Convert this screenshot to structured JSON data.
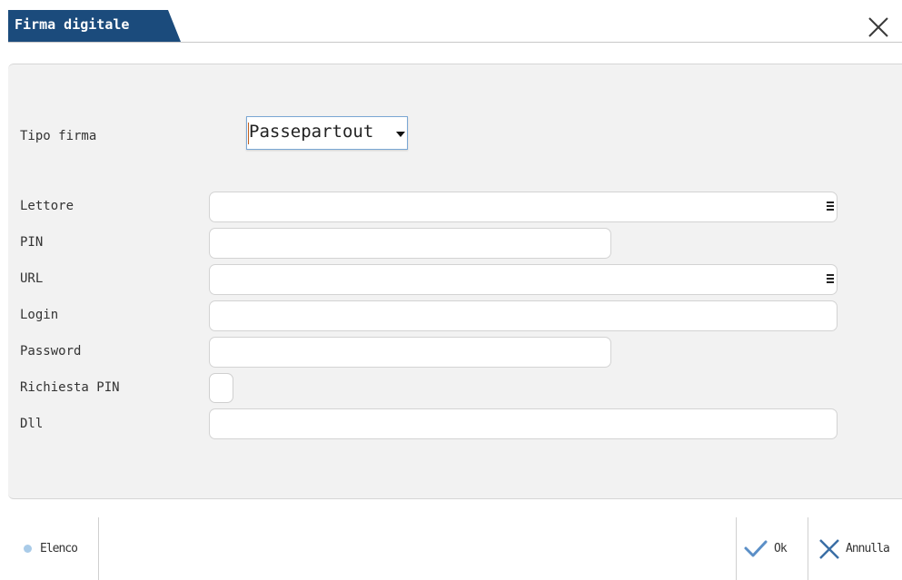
{
  "window": {
    "title": "Firma digitale"
  },
  "form": {
    "tipo_firma": {
      "label": "Tipo firma",
      "value": "Passepartout"
    },
    "lettore": {
      "label": "Lettore",
      "value": ""
    },
    "pin": {
      "label": "PIN",
      "value": ""
    },
    "url": {
      "label": "URL",
      "value": ""
    },
    "login": {
      "label": "Login",
      "value": ""
    },
    "password": {
      "label": "Password",
      "value": ""
    },
    "richiesta_pin": {
      "label": "Richiesta PIN",
      "checked": false
    },
    "dll": {
      "label": "Dll",
      "value": ""
    }
  },
  "footer": {
    "elenco": "Elenco",
    "ok": "Ok",
    "annulla": "Annulla"
  },
  "colors": {
    "title_tab": "#1b4b7c",
    "panel_bg": "#f2f2f2",
    "ok_check": "#5b8fc7",
    "annulla_x": "#3a6ea5"
  }
}
